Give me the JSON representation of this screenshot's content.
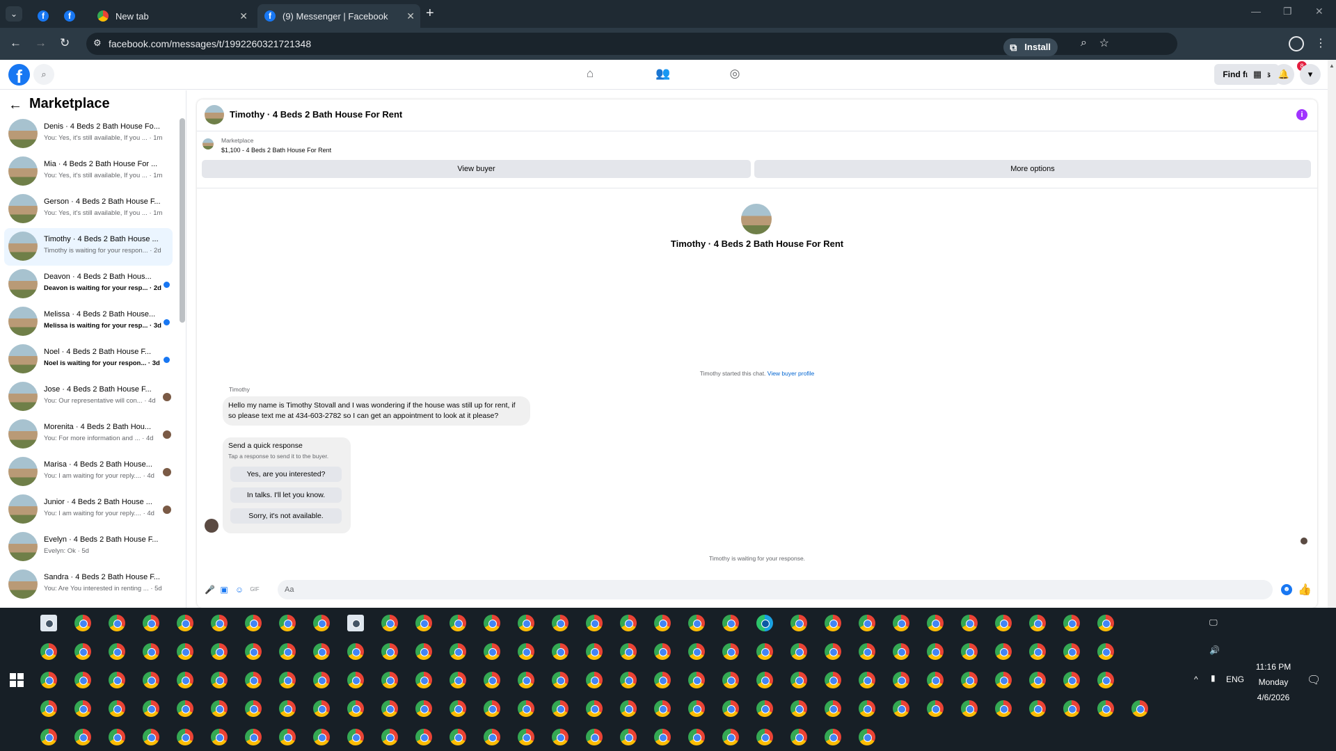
{
  "browser": {
    "tabs": [
      {
        "title": "",
        "icon": "facebook-icon"
      },
      {
        "title": "",
        "icon": "facebook-icon"
      },
      {
        "title": "New tab",
        "icon": "chrome-icon"
      },
      {
        "title": "(9) Messenger | Facebook",
        "icon": "facebook-icon"
      }
    ],
    "url": "facebook.com/messages/t/1992260321721348",
    "install_label": "Install"
  },
  "fb_header": {
    "find_friends_label": "Find friends",
    "notification_count": "8"
  },
  "sidebar": {
    "title": "Marketplace",
    "conversations": [
      {
        "name": "Denis · 4 Beds 2 Bath House Fo...",
        "snippet": "You: Yes, it's still available, If you ... · 1m",
        "unread": false,
        "indicator": "none"
      },
      {
        "name": "Mia · 4 Beds 2 Bath House For ...",
        "snippet": "You: Yes, it's still available, If you ... · 1m",
        "unread": false,
        "indicator": "none"
      },
      {
        "name": "Gerson · 4 Beds 2 Bath House F...",
        "snippet": "You: Yes, it's still available, If you ... · 1m",
        "unread": false,
        "indicator": "none"
      },
      {
        "name": "Timothy · 4 Beds 2 Bath House ...",
        "snippet": "Timothy is waiting for your respon... · 2d",
        "unread": false,
        "indicator": "none",
        "active": true
      },
      {
        "name": "Deavon · 4 Beds 2 Bath Hous...",
        "snippet": "Deavon is waiting for your resp... · 2d",
        "unread": true,
        "indicator": "dot"
      },
      {
        "name": "Melissa · 4 Beds 2 Bath House...",
        "snippet": "Melissa is waiting for your resp... · 3d",
        "unread": true,
        "indicator": "dot"
      },
      {
        "name": "Noel · 4 Beds 2 Bath House F...",
        "snippet": "Noel is waiting for your respon... · 3d",
        "unread": true,
        "indicator": "dot"
      },
      {
        "name": "Jose · 4 Beds 2 Bath House F...",
        "snippet": "You: Our representative will con... · 4d",
        "unread": false,
        "indicator": "seen"
      },
      {
        "name": "Morenita · 4 Beds 2 Bath Hou...",
        "snippet": "You: For more information and ... · 4d",
        "unread": false,
        "indicator": "seen"
      },
      {
        "name": "Marisa · 4 Beds 2 Bath House...",
        "snippet": "You: I am waiting for your reply.... · 4d",
        "unread": false,
        "indicator": "seen"
      },
      {
        "name": "Junior · 4 Beds 2 Bath House ...",
        "snippet": "You: I am waiting for your reply.... · 4d",
        "unread": false,
        "indicator": "seen"
      },
      {
        "name": "Evelyn · 4 Beds 2 Bath House F...",
        "snippet": "Evelyn: Ok · 5d",
        "unread": false,
        "indicator": "none"
      },
      {
        "name": "Sandra · 4 Beds 2 Bath House F...",
        "snippet": "You: Are You interested in renting ... · 5d",
        "unread": false,
        "indicator": "none"
      }
    ]
  },
  "chat": {
    "title": "Timothy · 4 Beds 2 Bath House For Rent",
    "listing_label": "Marketplace",
    "listing_price": "$1,100 - 4 Beds 2 Bath House For Rent",
    "view_buyer_label": "View buyer",
    "more_options_label": "More options",
    "intro_name": "Timothy · 4 Beds 2 Bath House For Rent",
    "started_text": "Timothy started this chat.",
    "view_buyer_profile": "View buyer profile",
    "sender": "Timothy",
    "message": "Hello my name is Timothy Stovall and I was wondering if the house was still up for rent, if so please text me at 434-603-2782 so I can get an appointment to look at it please?",
    "quick_title": "Send a quick response",
    "quick_subtitle": "Tap a response to send it to the buyer.",
    "quick_responses": [
      "Yes, are you interested?",
      "In talks. I'll let you know.",
      "Sorry, it's not available."
    ],
    "waiting_text": "Timothy is waiting for your response.",
    "input_placeholder": "Aa"
  },
  "taskbar": {
    "tray_language": "ENG",
    "time": "11:16 PM",
    "day": "Monday",
    "date": "4/6/2026"
  },
  "colors": {
    "facebook_blue": "#1877f2",
    "browser_bg": "#1f2a33",
    "taskbar_bg": "#171f26",
    "unread_dot": "#1877f2"
  }
}
